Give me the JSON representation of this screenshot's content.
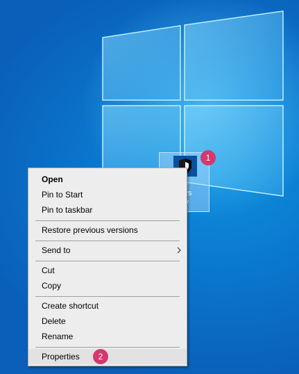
{
  "colors": {
    "desktop": "#0a78cf",
    "badge": "#d4386f",
    "menu_bg": "#ededed"
  },
  "desktop_icon": {
    "label_line1": "ows",
    "label_line2": "ity",
    "icon": "shield-icon"
  },
  "badges": {
    "first": "1",
    "second": "2"
  },
  "menu": {
    "items": [
      {
        "label": "Open"
      },
      {
        "label": "Pin to Start"
      },
      {
        "label": "Pin to taskbar"
      },
      {
        "label": "Restore previous versions"
      },
      {
        "label": "Send to",
        "submenu_icon": "chevron-right-icon"
      },
      {
        "label": "Cut"
      },
      {
        "label": "Copy"
      },
      {
        "label": "Create shortcut"
      },
      {
        "label": "Delete"
      },
      {
        "label": "Rename"
      },
      {
        "label": "Properties"
      }
    ]
  }
}
